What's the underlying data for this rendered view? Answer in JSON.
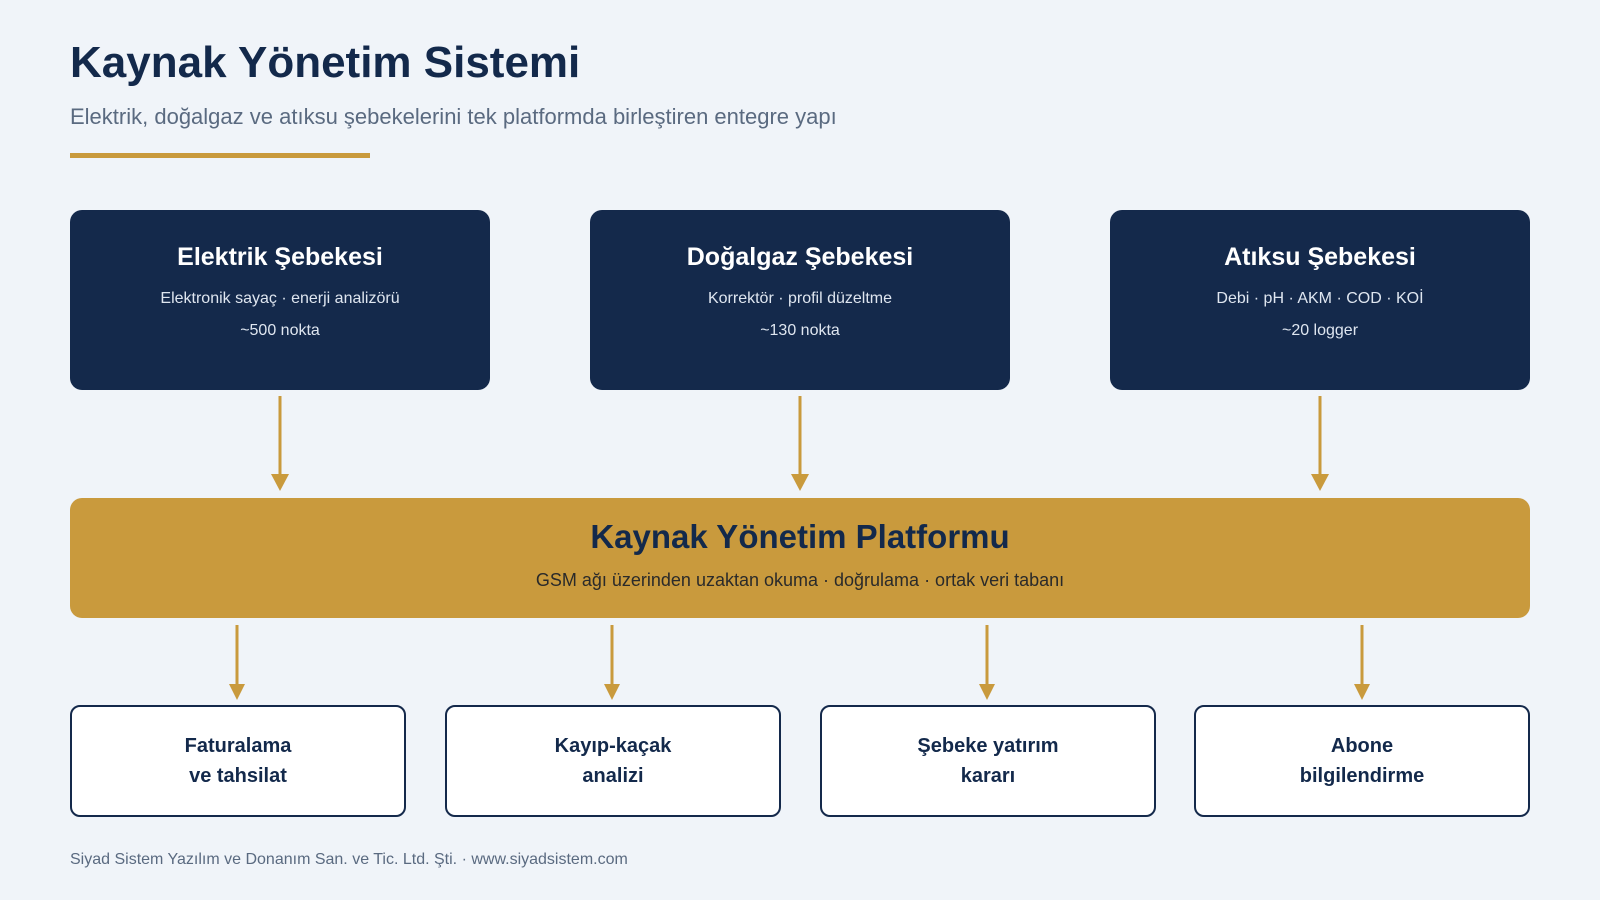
{
  "header": {
    "title": "Kaynak Yönetim Sistemi",
    "subtitle": "Elektrik, doğalgaz ve atıksu şebekelerini tek platformda birleştiren entegre yapı"
  },
  "sources": [
    {
      "title": "Elektrik Şebekesi",
      "desc": "Elektronik sayaç · enerji analizörü",
      "count": "~500 nokta"
    },
    {
      "title": "Doğalgaz Şebekesi",
      "desc": "Korrektör · profil düzeltme",
      "count": "~130 nokta"
    },
    {
      "title": "Atıksu Şebekesi",
      "desc": "Debi · pH · AKM · COD · KOİ",
      "count": "~20 logger"
    }
  ],
  "platform": {
    "title": "Kaynak Yönetim Platformu",
    "desc": "GSM ağı üzerinden uzaktan okuma · doğrulama · ortak veri tabanı"
  },
  "outputs": [
    {
      "line1": "Faturalama",
      "line2": "ve tahsilat"
    },
    {
      "line1": "Kayıp-kaçak",
      "line2": "analizi"
    },
    {
      "line1": "Şebeke yatırım",
      "line2": "kararı"
    },
    {
      "line1": "Abone",
      "line2": "bilgilendirme"
    }
  ],
  "footer": {
    "text": "Siyad Sistem Yazılım ve Donanım San. ve Tic. Ltd. Şti. · www.siyadsistem.com"
  },
  "colors": {
    "navy": "#14294b",
    "gold": "#c99a3d",
    "background": "#f0f4f9",
    "muted_text": "#5a6a80"
  }
}
